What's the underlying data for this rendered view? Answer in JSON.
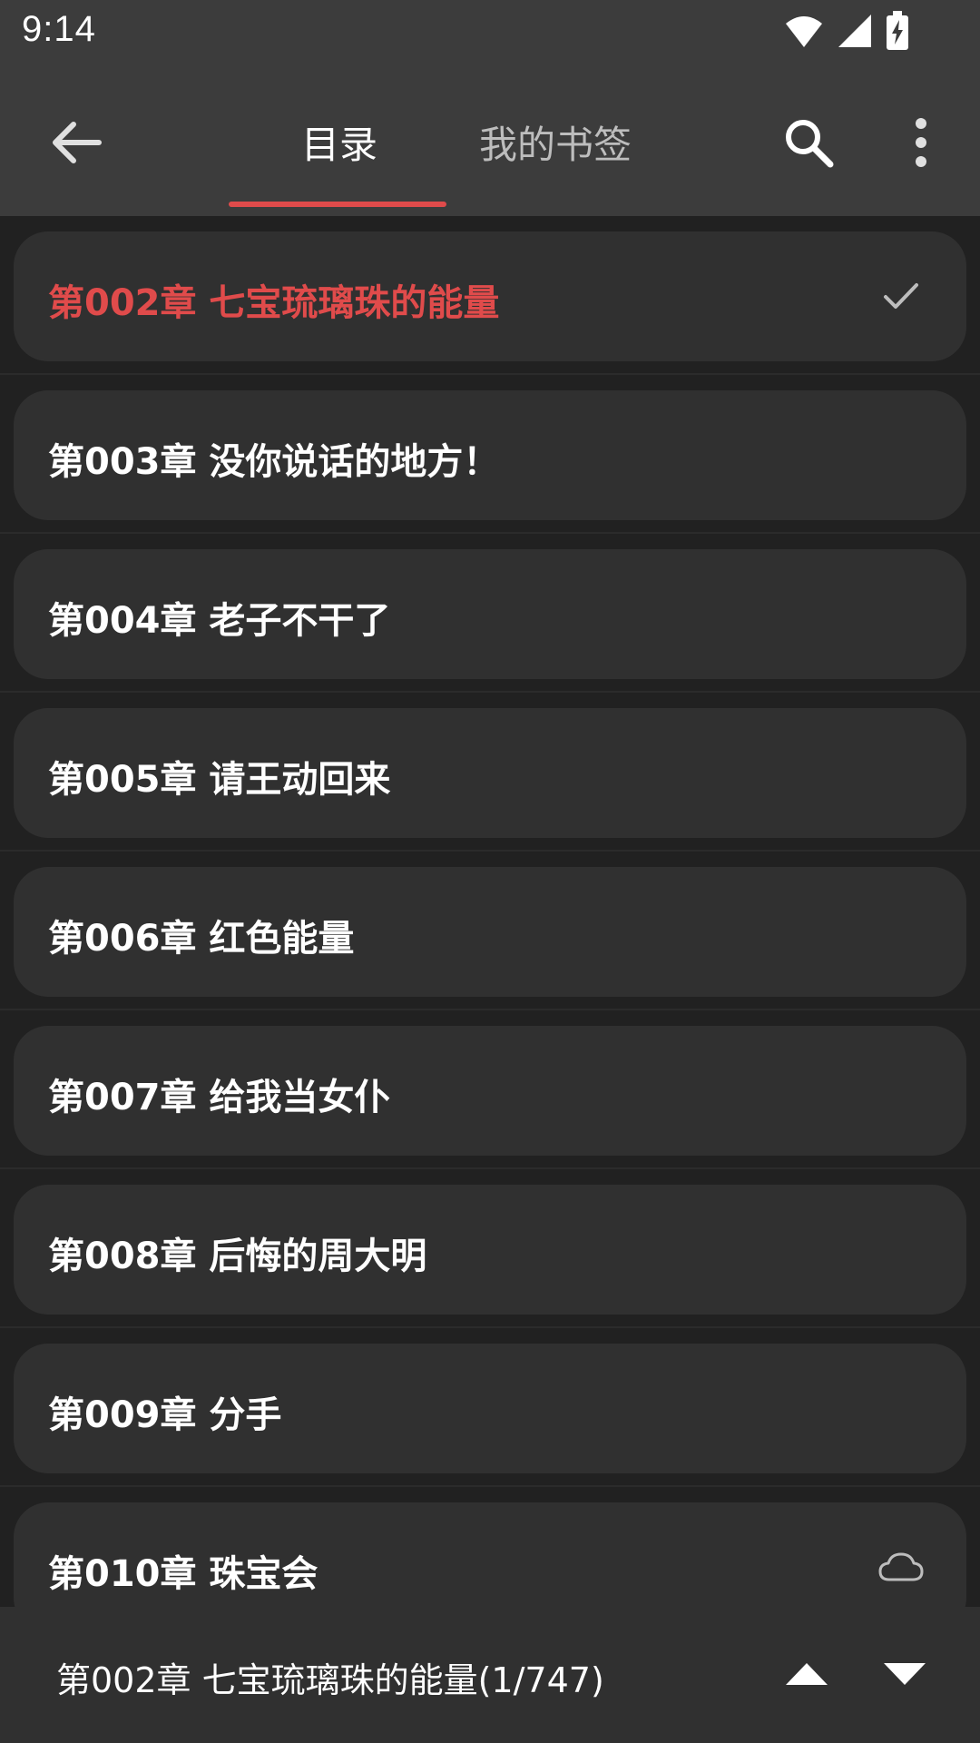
{
  "status_bar": {
    "time": "9:14",
    "icons": [
      "wifi-icon",
      "signal-icon",
      "battery-charging-icon"
    ]
  },
  "toolbar": {
    "tabs": [
      {
        "label": "目录",
        "active": true
      },
      {
        "label": "我的书签",
        "active": false
      }
    ],
    "icons": [
      "back-arrow-icon",
      "search-icon",
      "more-vert-icon"
    ]
  },
  "chapters": [
    {
      "title": "第002章 七宝琉璃珠的能量",
      "current": true,
      "icon": "check-icon"
    },
    {
      "title": "第003章 没你说话的地方！",
      "current": false,
      "icon": ""
    },
    {
      "title": "第004章 老子不干了",
      "current": false,
      "icon": ""
    },
    {
      "title": "第005章 请王动回来",
      "current": false,
      "icon": ""
    },
    {
      "title": "第006章 红色能量",
      "current": false,
      "icon": ""
    },
    {
      "title": "第007章 给我当女仆",
      "current": false,
      "icon": ""
    },
    {
      "title": "第008章 后悔的周大明",
      "current": false,
      "icon": ""
    },
    {
      "title": "第009章 分手",
      "current": false,
      "icon": ""
    },
    {
      "title": "第010章 珠宝会",
      "current": false,
      "icon": "cloud-icon"
    }
  ],
  "bottom_bar": {
    "label": "第002章 七宝琉璃珠的能量(1/747)",
    "icons": [
      "arrow-up-icon",
      "arrow-down-icon"
    ]
  },
  "colors": {
    "accent": "#e04b4b",
    "toolbar_bg": "#3c3c3c",
    "card_bg": "#303030",
    "page_bg": "#212121"
  }
}
